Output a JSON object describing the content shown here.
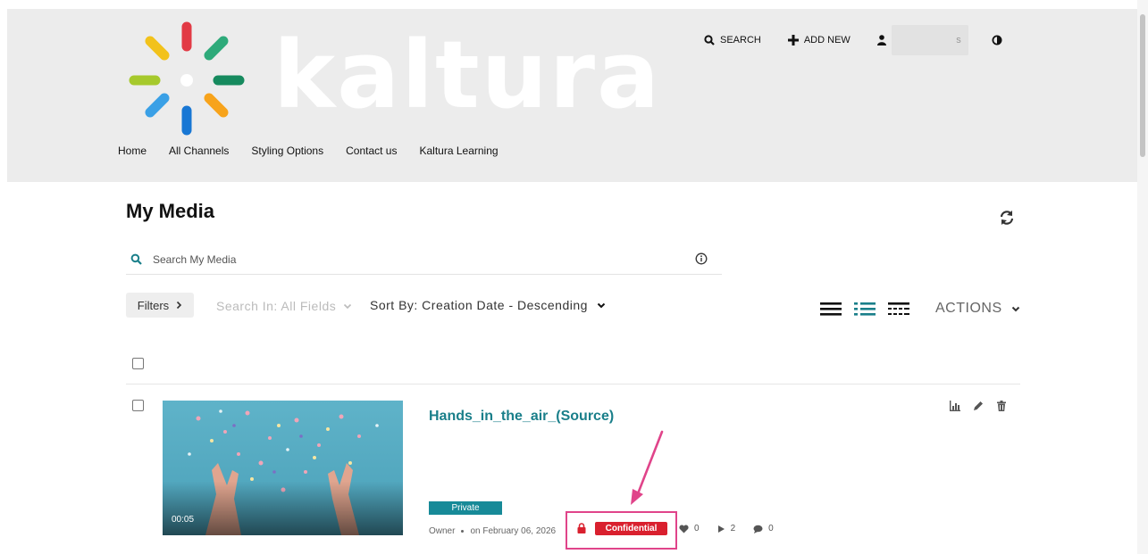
{
  "logo": {
    "wordmark": "kaltura"
  },
  "topnav": {
    "search_label": "SEARCH",
    "add_new_label": "ADD NEW",
    "user_name_tail": "s"
  },
  "mainnav": {
    "items": [
      "Home",
      "All Channels",
      "Styling Options",
      "Contact us",
      "Kaltura Learning"
    ]
  },
  "page": {
    "title": "My Media",
    "search_placeholder": "Search My Media"
  },
  "toolbar": {
    "filters_label": "Filters",
    "search_in_label": "Search In: All Fields",
    "sort_by_label": "Sort By: Creation Date - Descending",
    "actions_label": "ACTIONS"
  },
  "media": {
    "title": "Hands_in_the_air_(Source)",
    "duration": "00:05",
    "privacy_badge": "Private",
    "owner": "Owner",
    "date": "on February 06, 2026",
    "sensitivity_badge": "Confidential",
    "likes": "0",
    "plays": "2",
    "comments": "0"
  },
  "colors": {
    "accent": "#1a7f8a",
    "private_badge": "#178a98",
    "confidential_badge": "#d9202e",
    "highlight": "#e0448a",
    "header_bg": "#ececec"
  }
}
